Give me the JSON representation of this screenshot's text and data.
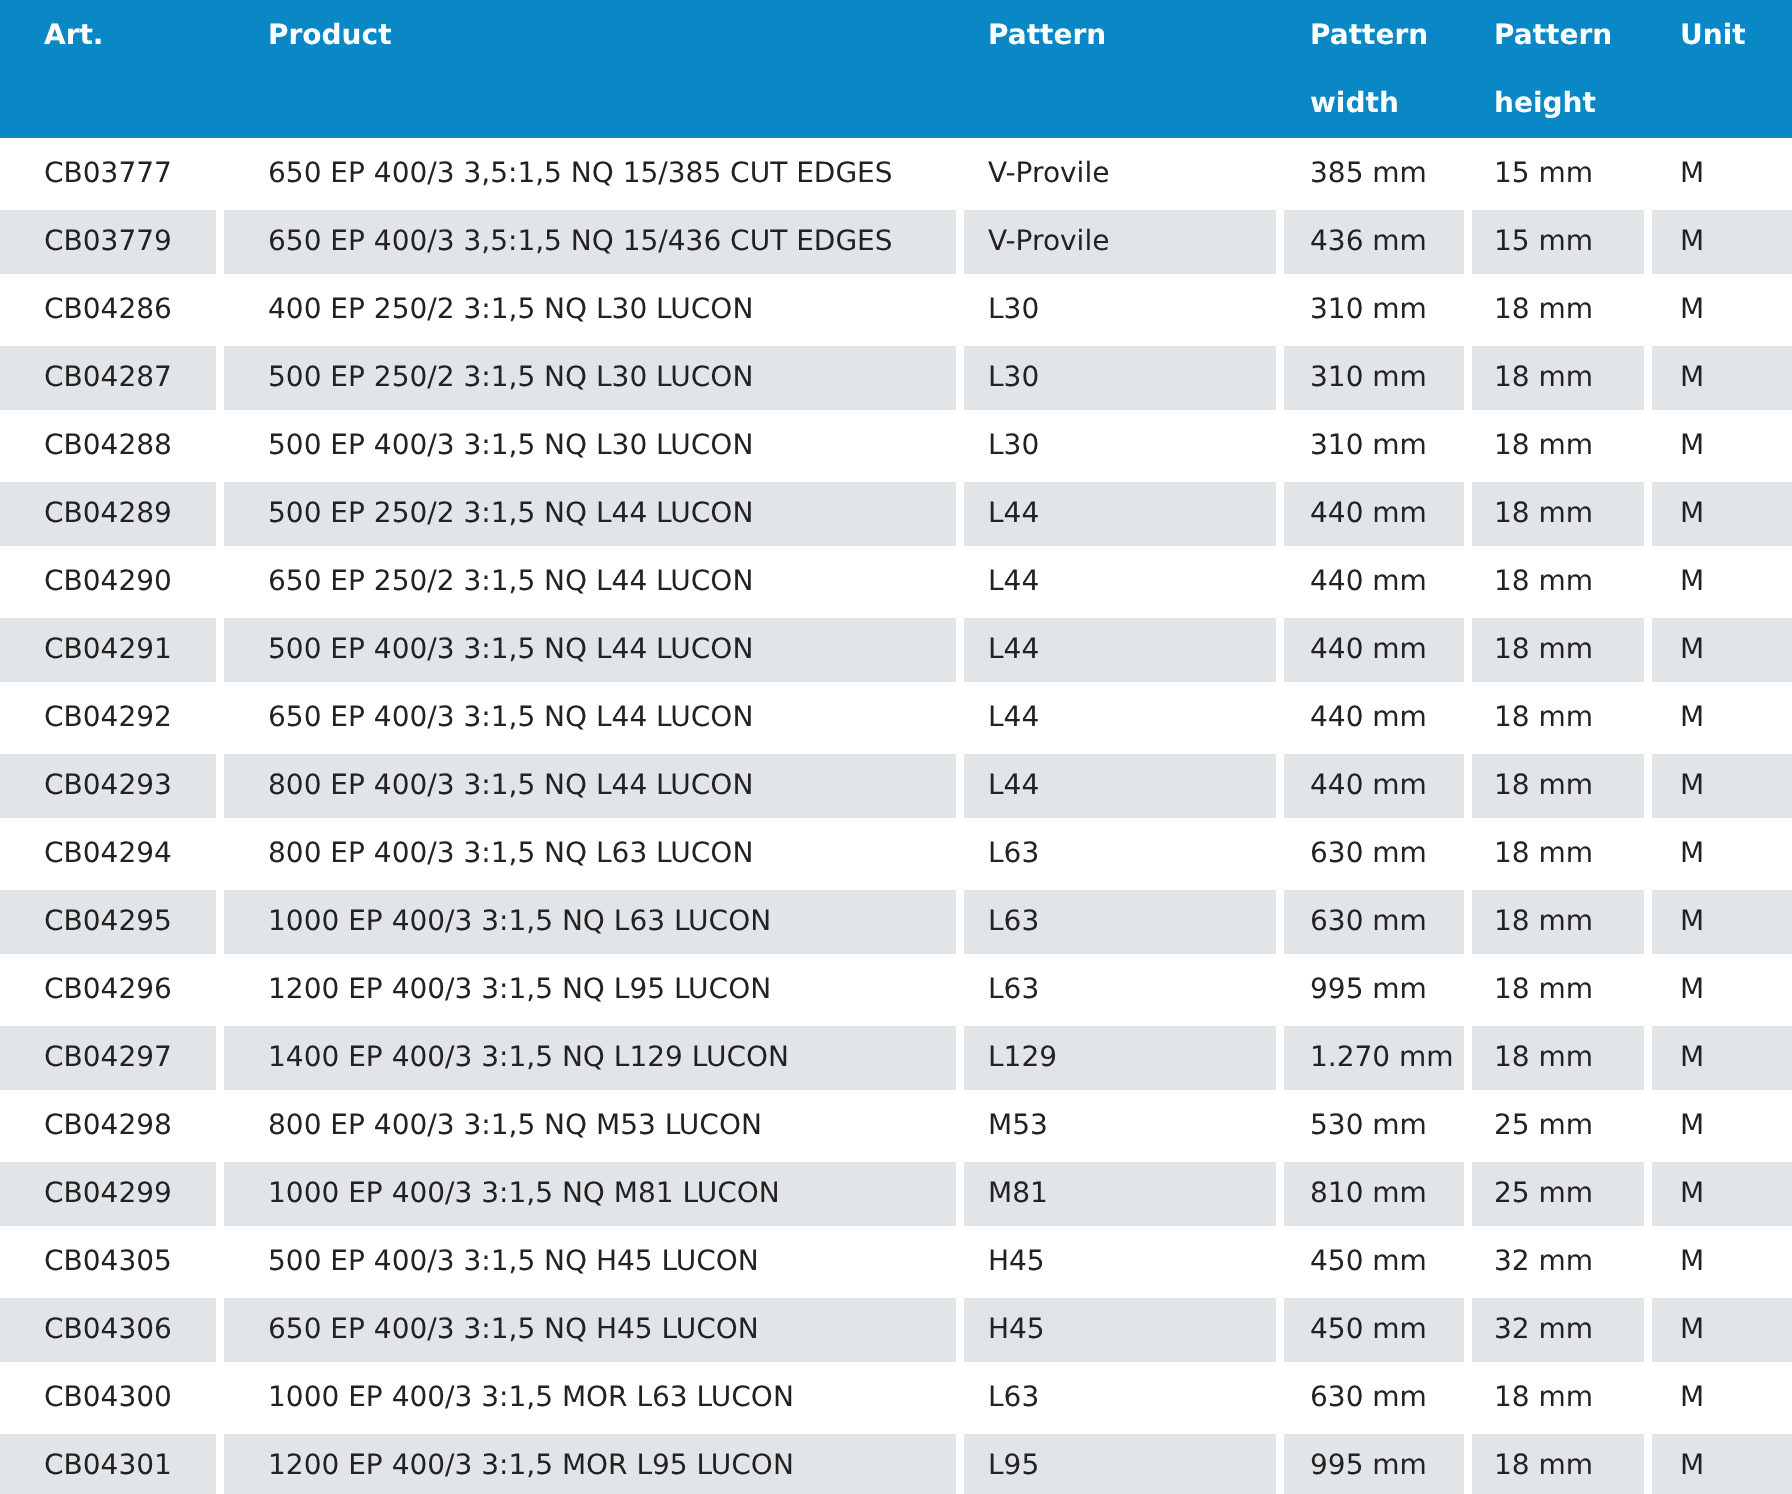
{
  "table": {
    "columns": [
      "Art.",
      "Product",
      "Pattern",
      "Pattern width",
      "Pattern height",
      "Unit"
    ],
    "rows": [
      [
        "CB03777",
        "650 EP 400/3 3,5:1,5 NQ 15/385 CUT EDGES",
        "V-Provile",
        "385 mm",
        "15 mm",
        "M"
      ],
      [
        "CB03779",
        "650 EP 400/3 3,5:1,5 NQ 15/436 CUT EDGES",
        "V-Provile",
        "436 mm",
        "15 mm",
        "M"
      ],
      [
        "CB04286",
        "400 EP 250/2 3:1,5 NQ L30 LUCON",
        "L30",
        "310 mm",
        "18 mm",
        "M"
      ],
      [
        "CB04287",
        "500 EP 250/2 3:1,5 NQ L30 LUCON",
        "L30",
        "310 mm",
        "18 mm",
        "M"
      ],
      [
        "CB04288",
        "500 EP 400/3 3:1,5 NQ L30 LUCON",
        "L30",
        "310 mm",
        "18 mm",
        "M"
      ],
      [
        "CB04289",
        "500 EP 250/2 3:1,5 NQ L44 LUCON",
        "L44",
        "440 mm",
        "18 mm",
        "M"
      ],
      [
        "CB04290",
        "650 EP 250/2 3:1,5 NQ L44 LUCON",
        "L44",
        "440 mm",
        "18 mm",
        "M"
      ],
      [
        "CB04291",
        "500 EP 400/3 3:1,5 NQ L44 LUCON",
        "L44",
        "440 mm",
        "18 mm",
        "M"
      ],
      [
        "CB04292",
        "650 EP 400/3 3:1,5 NQ L44 LUCON",
        "L44",
        "440 mm",
        "18 mm",
        "M"
      ],
      [
        "CB04293",
        "800 EP 400/3 3:1,5 NQ L44 LUCON",
        "L44",
        "440 mm",
        "18 mm",
        "M"
      ],
      [
        "CB04294",
        "800 EP 400/3 3:1,5 NQ L63 LUCON",
        "L63",
        "630 mm",
        "18 mm",
        "M"
      ],
      [
        "CB04295",
        "1000 EP 400/3 3:1,5 NQ L63 LUCON",
        "L63",
        "630 mm",
        "18 mm",
        "M"
      ],
      [
        "CB04296",
        "1200 EP 400/3 3:1,5 NQ L95 LUCON",
        "L63",
        "995 mm",
        "18 mm",
        "M"
      ],
      [
        "CB04297",
        "1400 EP 400/3 3:1,5 NQ L129 LUCON",
        "L129",
        "1.270 mm",
        "18 mm",
        "M"
      ],
      [
        "CB04298",
        "800 EP 400/3 3:1,5 NQ M53 LUCON",
        "M53",
        "530 mm",
        "25 mm",
        "M"
      ],
      [
        "CB04299",
        "1000 EP 400/3 3:1,5 NQ M81 LUCON",
        "M81",
        "810 mm",
        "25 mm",
        "M"
      ],
      [
        "CB04305",
        "500 EP 400/3 3:1,5 NQ H45 LUCON",
        "H45",
        "450 mm",
        "32 mm",
        "M"
      ],
      [
        "CB04306",
        "650 EP 400/3 3:1,5 NQ H45 LUCON",
        "H45",
        "450 mm",
        "32 mm",
        "M"
      ],
      [
        "CB04300",
        "1000 EP 400/3 3:1,5 MOR L63 LUCON",
        "L63",
        "630 mm",
        "18 mm",
        "M"
      ],
      [
        "CB04301",
        "1200 EP 400/3 3:1,5 MOR L95 LUCON",
        "L95",
        "995 mm",
        "18 mm",
        "M"
      ]
    ]
  }
}
